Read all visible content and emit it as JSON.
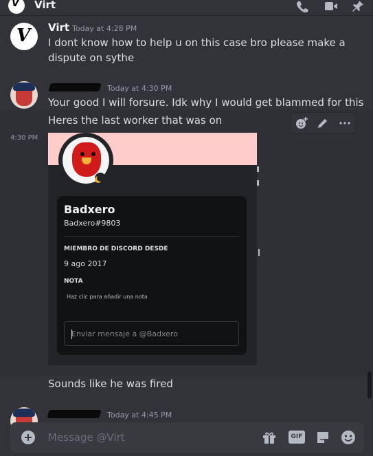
{
  "header": {
    "channel_name": "Virt",
    "avatar_letter": "V"
  },
  "messages": [
    {
      "author": "Virt",
      "timestamp": "Today at 4:28 PM",
      "lines": [
        "I dont know how to help u on this case bro please make a",
        "dispute on sythe"
      ]
    },
    {
      "author_censored": true,
      "timestamp": "Today at 4:30 PM",
      "lines": [
        "Your good I will forsure. Idk why I would get blammed for this",
        "Heres the last worker that was on"
      ]
    },
    {
      "side_timestamp": "4:30 PM",
      "embed": {
        "display_name": "Badxero",
        "username": "Badxero#9803",
        "member_since_label": "MIEMBRO DE DISCORD DESDE",
        "member_since_value": "9 ago 2017",
        "note_label": "NOTA",
        "note_placeholder": "Haz clic para añadir una nota",
        "dm_placeholder": "Enviar mensaje a @Badxero",
        "banner_color": "#ffcccc"
      }
    },
    {
      "text": "Sounds like he was fired"
    },
    {
      "author_censored": true,
      "timestamp": "Today at 4:45 PM"
    }
  ],
  "composer": {
    "placeholder": "Message @Virt",
    "gif_label": "GIF"
  }
}
